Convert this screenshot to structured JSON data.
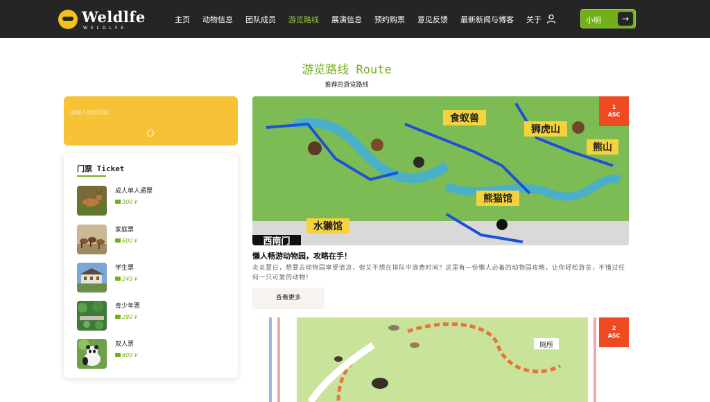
{
  "brand": {
    "name": "Weldlfe",
    "sub": "WELDLFE"
  },
  "nav": {
    "items": [
      {
        "label": "主页",
        "active": false
      },
      {
        "label": "动物信息",
        "active": false
      },
      {
        "label": "团队成员",
        "active": false
      },
      {
        "label": "游览路线",
        "active": true
      },
      {
        "label": "展演信息",
        "active": false
      },
      {
        "label": "预约购票",
        "active": false
      },
      {
        "label": "意见反馈",
        "active": false
      },
      {
        "label": "最新新闻与博客",
        "active": false
      },
      {
        "label": "关于",
        "active": false
      }
    ],
    "user_icon": "user-icon",
    "user_button": {
      "label": "小明",
      "icon": "arrow-right-icon"
    }
  },
  "page": {
    "title": "游览路线 Route",
    "subtitle": "推荐的游览路线"
  },
  "search": {
    "placeholder": "请输入搜索内容",
    "icon": "search-icon"
  },
  "tickets": {
    "title": "门票 Ticket",
    "items": [
      {
        "name": "成人单人通票",
        "price": "300￥"
      },
      {
        "name": "家庭票",
        "price": "600￥"
      },
      {
        "name": "学生票",
        "price": "245￥"
      },
      {
        "name": "青少年票",
        "price": "280￥"
      },
      {
        "name": "双人票",
        "price": "600￥"
      }
    ]
  },
  "routes": [
    {
      "badge_num": "1",
      "badge_text": "ASC",
      "title": "懒人畅游动物园，攻略在手！",
      "desc": "炎炎夏日，想要去动物园享受清凉，但又不想在排队中浪费时间？这里有一份懒人必备的动物园攻略，让你轻松游览，不错过任何一只可爱的动物！",
      "button": "查看更多",
      "map_labels": {
        "anteater": "食蚁兽",
        "tiger": "狮虎山",
        "bear": "熊山",
        "panda": "熊猫馆",
        "otter": "水獭馆",
        "gate": "西南门"
      }
    },
    {
      "badge_num": "2",
      "badge_text": "ASC",
      "map_labels": {
        "toilet": "厕所"
      }
    }
  ]
}
